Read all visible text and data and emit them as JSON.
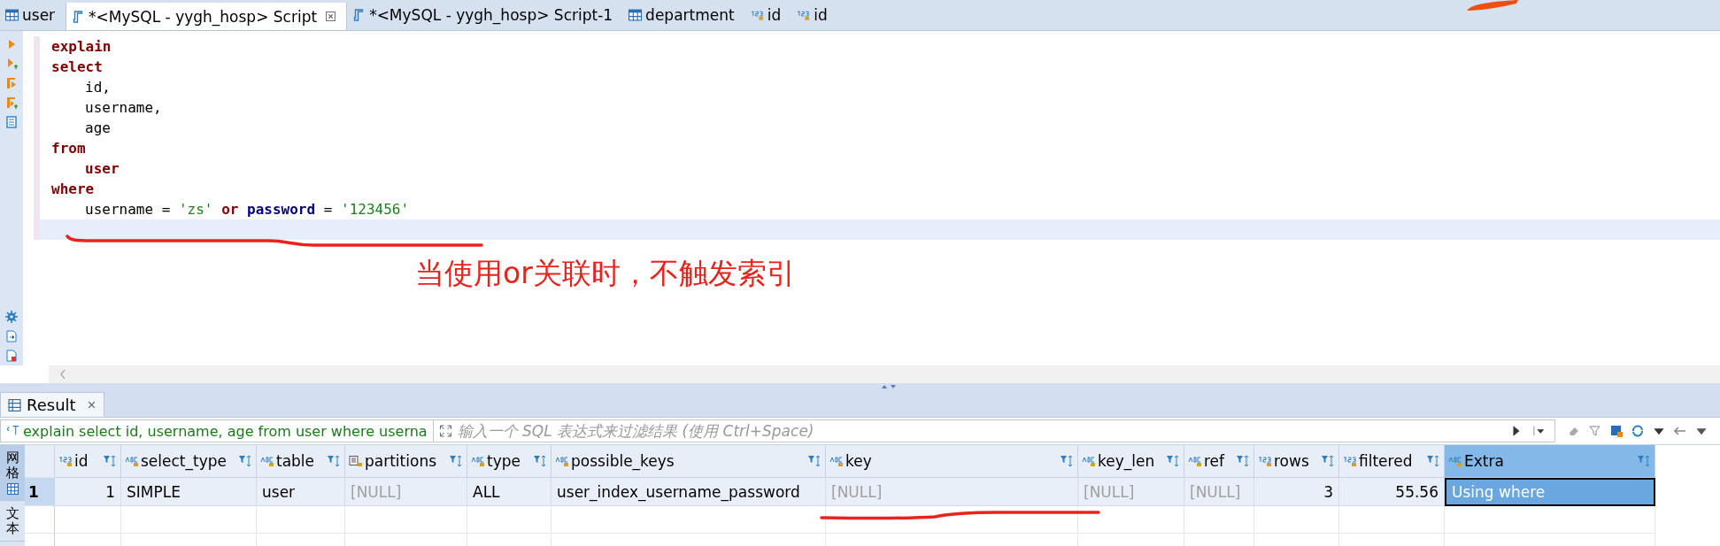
{
  "tabs": [
    {
      "label": "user",
      "kind": "table",
      "selected": false,
      "closable": false
    },
    {
      "label": "*<MySQL - yygh_hosp> Script",
      "kind": "script",
      "selected": true,
      "closable": true
    },
    {
      "label": "*<MySQL - yygh_hosp> Script-1",
      "kind": "script",
      "selected": false,
      "closable": false
    },
    {
      "label": "department",
      "kind": "table",
      "selected": false,
      "closable": false
    },
    {
      "label": "id",
      "kind": "number",
      "selected": false,
      "closable": false
    },
    {
      "label": "id",
      "kind": "number",
      "selected": false,
      "closable": false
    }
  ],
  "editor": {
    "lines": [
      {
        "indented": false,
        "tokens": [
          {
            "text": "explain",
            "kind": "keyword"
          }
        ]
      },
      {
        "indented": false,
        "tokens": [
          {
            "text": "select",
            "kind": "keyword"
          }
        ]
      },
      {
        "indented": true,
        "tokens": [
          {
            "text": "id,",
            "kind": "plain"
          }
        ]
      },
      {
        "indented": true,
        "tokens": [
          {
            "text": "username,",
            "kind": "plain"
          }
        ]
      },
      {
        "indented": true,
        "tokens": [
          {
            "text": "age",
            "kind": "plain"
          }
        ]
      },
      {
        "indented": false,
        "tokens": [
          {
            "text": "from",
            "kind": "keyword"
          }
        ]
      },
      {
        "indented": true,
        "tokens": [
          {
            "text": "user",
            "kind": "keyword"
          }
        ]
      },
      {
        "indented": false,
        "tokens": [
          {
            "text": "where",
            "kind": "keyword"
          }
        ]
      },
      {
        "indented": true,
        "tokens": [
          {
            "text": "username = ",
            "kind": "plain"
          },
          {
            "text": "'zs'",
            "kind": "string"
          },
          {
            "text": " or ",
            "kind": "keyword"
          },
          {
            "text": "password",
            "kind": "column"
          },
          {
            "text": " = ",
            "kind": "plain"
          },
          {
            "text": "'123456'",
            "kind": "string"
          }
        ]
      }
    ],
    "annotation": "当使用or关联时，不触发索引"
  },
  "result_tab": {
    "label": "Result",
    "selected": true
  },
  "filter": {
    "value": "explain select id, username, age from user where userna",
    "placeholder": "输入一个 SQL 表达式来过滤结果 (使用 Ctrl+Space)"
  },
  "side_tabs": [
    {
      "label": "网格",
      "selected": true
    },
    {
      "label": "文本",
      "selected": false
    }
  ],
  "table": {
    "columns": [
      {
        "name": "id",
        "kind": "number",
        "selected": false
      },
      {
        "name": "select_type",
        "kind": "string",
        "selected": false
      },
      {
        "name": "table",
        "kind": "string",
        "selected": false
      },
      {
        "name": "partitions",
        "kind": "doc",
        "selected": false
      },
      {
        "name": "type",
        "kind": "string",
        "selected": false
      },
      {
        "name": "possible_keys",
        "kind": "string",
        "selected": false
      },
      {
        "name": "key",
        "kind": "string",
        "selected": false
      },
      {
        "name": "key_len",
        "kind": "string",
        "selected": false
      },
      {
        "name": "ref",
        "kind": "string",
        "selected": false
      },
      {
        "name": "rows",
        "kind": "number",
        "selected": false
      },
      {
        "name": "filtered",
        "kind": "number",
        "selected": false
      },
      {
        "name": "Extra",
        "kind": "string",
        "selected": true
      }
    ],
    "rows": [
      {
        "number": "1",
        "cells": [
          {
            "text": "1",
            "null": false,
            "selected": false
          },
          {
            "text": "SIMPLE",
            "null": false,
            "selected": false
          },
          {
            "text": "user",
            "null": false,
            "selected": false
          },
          {
            "text": "[NULL]",
            "null": true,
            "selected": false
          },
          {
            "text": "ALL",
            "null": false,
            "selected": false
          },
          {
            "text": "user_index_username_password",
            "null": false,
            "selected": false
          },
          {
            "text": "[NULL]",
            "null": true,
            "selected": false
          },
          {
            "text": "[NULL]",
            "null": true,
            "selected": false
          },
          {
            "text": "[NULL]",
            "null": true,
            "selected": false
          },
          {
            "text": "3",
            "null": false,
            "selected": false
          },
          {
            "text": "55.56",
            "null": false,
            "selected": false
          },
          {
            "text": "Using where",
            "null": false,
            "selected": true
          }
        ]
      }
    ]
  }
}
